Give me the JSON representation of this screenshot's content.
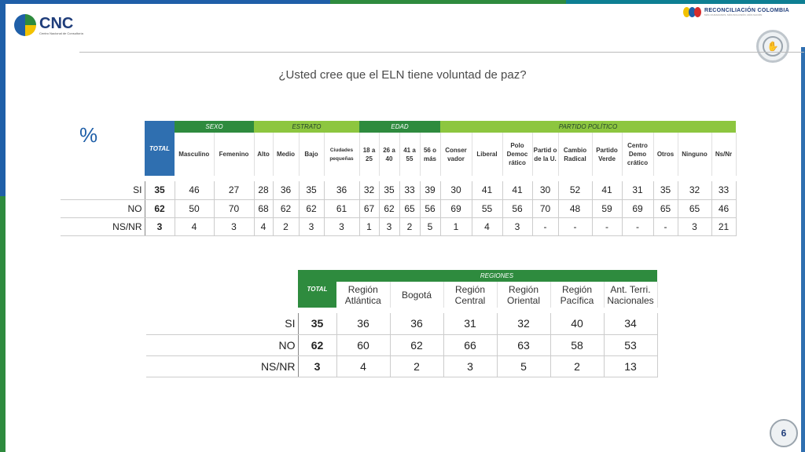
{
  "logo": {
    "name": "CNC",
    "subtitle": "Centro Nacional de Consultoría"
  },
  "brand": {
    "name": "RECONCILIACIÓN COLOMBIA",
    "tagline": "MÁS CIUDADANOS, MÁS INCLUSIÓN, MÁS NACIÓN"
  },
  "title": "¿Usted cree que el ELN tiene voluntad de paz?",
  "percent_symbol": "%",
  "table1": {
    "total_label": "TOTAL",
    "groups": {
      "sexo": "SEXO",
      "estrato": "ESTRATO",
      "edad": "EDAD",
      "partido": "PARTIDO POLÍTICO"
    },
    "columns": [
      "Masculino",
      "Femenino",
      "Alto",
      "Medio",
      "Bajo",
      "Ciudades pequeñas",
      "18 a 25",
      "26 a 40",
      "41 a 55",
      "56 o más",
      "Conser vador",
      "Liberal",
      "Polo Democ rático",
      "Partid o de la U.",
      "Cambio Radical",
      "Partido Verde",
      "Centro Demo crático",
      "Otros",
      "Ninguno",
      "Ns/Nr"
    ],
    "rows": [
      {
        "label": "SI",
        "total": "35",
        "values": [
          "46",
          "27",
          "28",
          "36",
          "35",
          "36",
          "32",
          "35",
          "33",
          "39",
          "30",
          "41",
          "41",
          "30",
          "52",
          "41",
          "31",
          "35",
          "32",
          "33"
        ]
      },
      {
        "label": "NO",
        "total": "62",
        "values": [
          "50",
          "70",
          "68",
          "62",
          "62",
          "61",
          "67",
          "62",
          "65",
          "56",
          "69",
          "55",
          "56",
          "70",
          "48",
          "59",
          "69",
          "65",
          "65",
          "46"
        ]
      },
      {
        "label": "NS/NR",
        "total": "3",
        "values": [
          "4",
          "3",
          "4",
          "2",
          "3",
          "3",
          "1",
          "3",
          "2",
          "5",
          "1",
          "4",
          "3",
          "-",
          "-",
          "-",
          "-",
          "-",
          "3",
          "21"
        ]
      }
    ]
  },
  "table2": {
    "total_label": "TOTAL",
    "group": "REGIONES",
    "columns": [
      "Región Atlántica",
      "Bogotá",
      "Región Central",
      "Región Oriental",
      "Región Pacífica",
      "Ant. Terri. Nacionales"
    ],
    "rows": [
      {
        "label": "SI",
        "total": "35",
        "values": [
          "36",
          "36",
          "31",
          "32",
          "40",
          "34"
        ]
      },
      {
        "label": "NO",
        "total": "62",
        "values": [
          "60",
          "62",
          "66",
          "63",
          "58",
          "53"
        ]
      },
      {
        "label": "NS/NR",
        "total": "3",
        "values": [
          "4",
          "2",
          "3",
          "5",
          "2",
          "13"
        ]
      }
    ]
  },
  "page_number": "6",
  "colors": {
    "blue": "#2f6fb0",
    "dark_green": "#2e8b3e",
    "light_green": "#8dc63f"
  }
}
